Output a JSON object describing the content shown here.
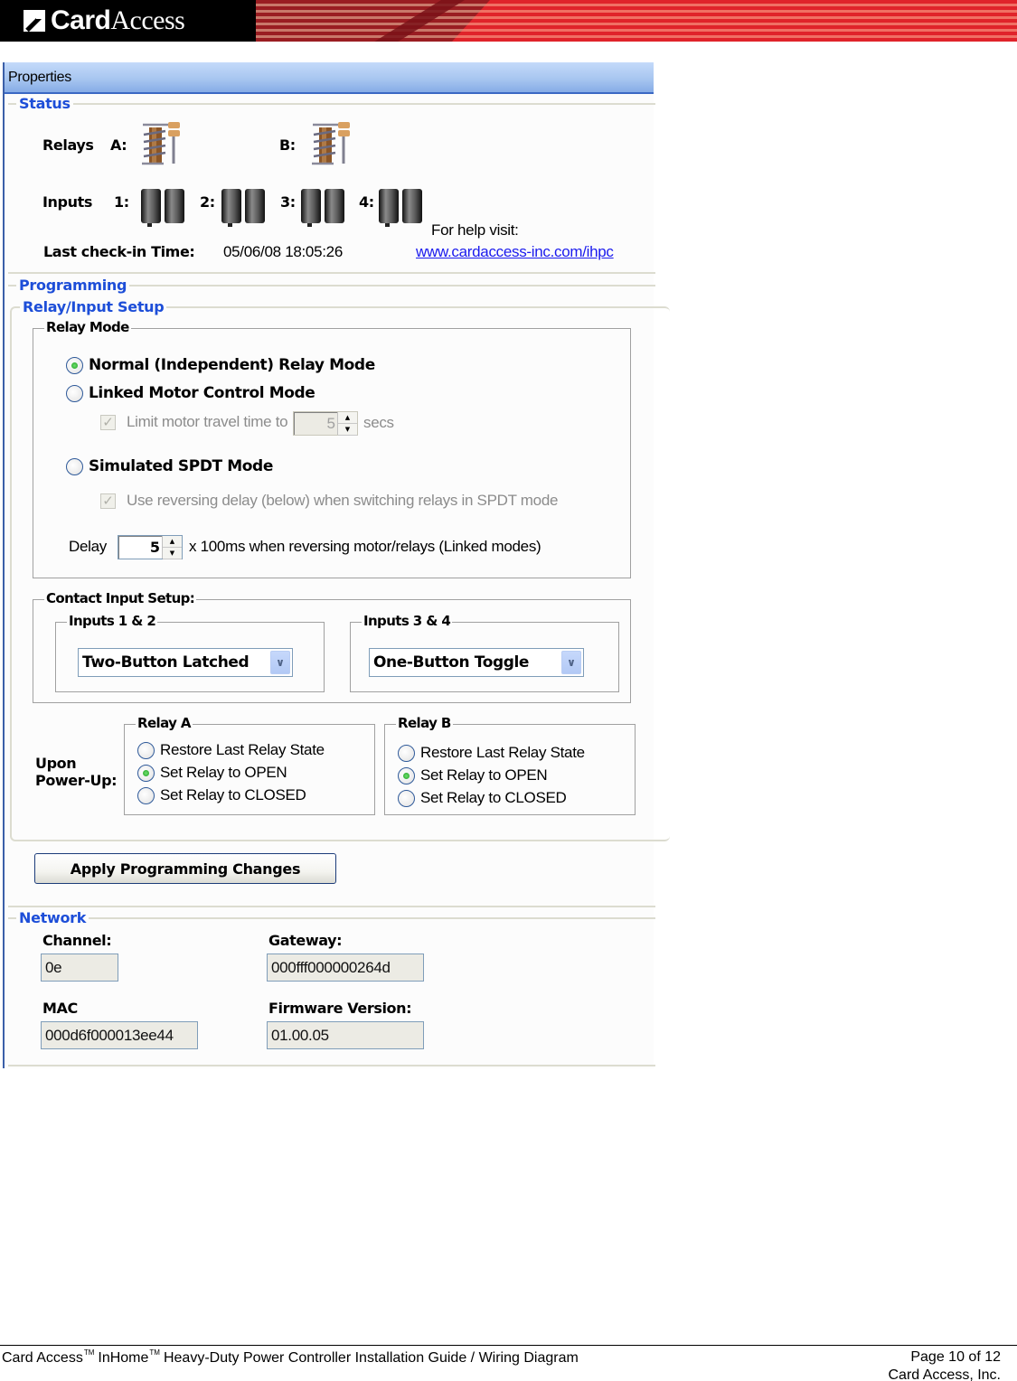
{
  "header": {
    "logo_bold": "Card",
    "logo_regular": "Access"
  },
  "panel": {
    "title": "Properties",
    "status": {
      "section_title": "Status",
      "relays_label": "Relays",
      "relay_a_label": "A:",
      "relay_b_label": "B:",
      "relay_icon": "relay-coil-icon",
      "inputs_label": "Inputs",
      "inputs": [
        {
          "label": "1:",
          "icon": "input-contact-icon"
        },
        {
          "label": "2:",
          "icon": "input-contact-icon"
        },
        {
          "label": "3:",
          "icon": "input-contact-icon"
        },
        {
          "label": "4:",
          "icon": "input-contact-icon"
        }
      ],
      "last_checkin_label": "Last check-in Time:",
      "last_checkin_value": "05/06/08 18:05:26",
      "help_text": "For help visit:",
      "help_link": "www.cardaccess-inc.com/ihpc"
    },
    "programming": {
      "section_title": "Programming",
      "relay_input_setup_title": "Relay/Input Setup",
      "relay_mode": {
        "group_title": "Relay Mode",
        "options": [
          {
            "label": "Normal (Independent) Relay Mode",
            "selected": true
          },
          {
            "label": "Linked Motor Control Mode",
            "selected": false
          },
          {
            "label": "Simulated SPDT Mode",
            "selected": false
          }
        ],
        "limit_motor": {
          "label": "Limit motor travel time to",
          "checked": true,
          "disabled": true,
          "value": "5",
          "unit": "secs"
        },
        "reversing_delay_check": {
          "label": "Use reversing delay (below) when switching relays in SPDT mode",
          "checked": true,
          "disabled": true
        },
        "delay": {
          "label": "Delay",
          "value": "5",
          "suffix": "x 100ms when reversing motor/relays (Linked modes)"
        }
      },
      "contact_input_setup": {
        "group_title": "Contact Input Setup:",
        "inputs_1_2": {
          "title": "Inputs 1 & 2",
          "selected": "Two-Button Latched"
        },
        "inputs_3_4": {
          "title": "Inputs 3 & 4",
          "selected": "One-Button Toggle"
        }
      },
      "power_up": {
        "label_line1": "Upon",
        "label_line2": "Power-Up:",
        "relay_a": {
          "title": "Relay A",
          "options": [
            {
              "label": "Restore Last Relay State",
              "selected": false
            },
            {
              "label": "Set Relay to OPEN",
              "selected": true
            },
            {
              "label": "Set Relay to CLOSED",
              "selected": false
            }
          ]
        },
        "relay_b": {
          "title": "Relay B",
          "options": [
            {
              "label": "Restore Last Relay State",
              "selected": false
            },
            {
              "label": "Set Relay to OPEN",
              "selected": true
            },
            {
              "label": "Set Relay to CLOSED",
              "selected": false
            }
          ]
        }
      },
      "apply_button": "Apply Programming Changes"
    },
    "network": {
      "section_title": "Network",
      "channel_label": "Channel:",
      "channel_value": "0e",
      "gateway_label": "Gateway:",
      "gateway_value": "000fff000000264d",
      "mac_label": "MAC",
      "mac_value": "000d6f000013ee44",
      "firmware_label": "Firmware Version:",
      "firmware_value": "01.00.05"
    }
  },
  "footer": {
    "brand": "Card Access",
    "tm": "TM",
    "product": "InHome",
    "title": "Heavy-Duty Power Controller Installation Guide / Wiring Diagram",
    "page": "Page 10 of 12",
    "company": "Card Access, Inc."
  }
}
